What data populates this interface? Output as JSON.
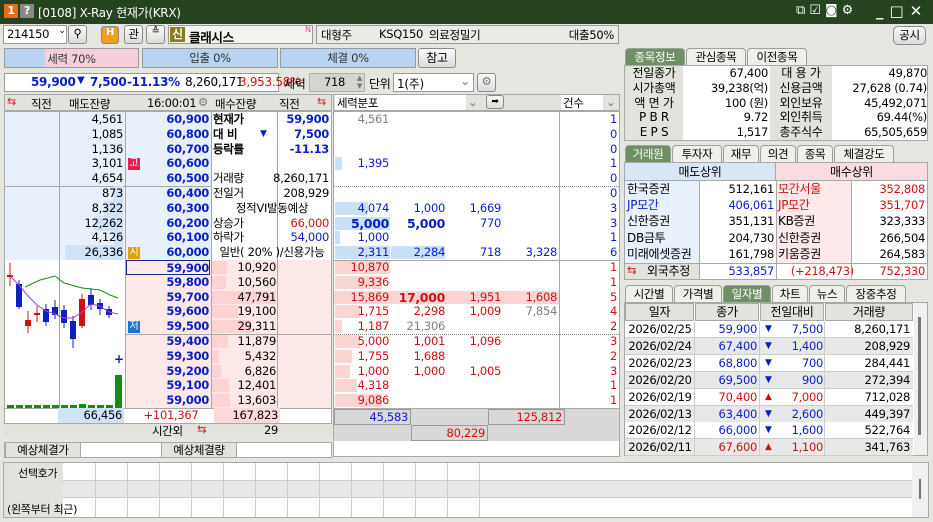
{
  "window": {
    "title": "[0108] X-Ray 현재가(KRX)",
    "badge1": "1",
    "badge2": "?"
  },
  "stock": {
    "code": "214150",
    "name": "클래시스",
    "credit_badge": "신",
    "gwan": "관",
    "new_mark": "N",
    "class": "대형주",
    "index": "KSQ150",
    "sector": "의료정밀기",
    "loan": "대출50%"
  },
  "strength": {
    "seryeok": "세력 70%",
    "seryeok_pct": 70,
    "ipchul": "입출 0%",
    "chegyeol": "체결 0%",
    "ref_button": "참고"
  },
  "summary": {
    "price": "59,900",
    "arrow": "▼",
    "change": "7,500",
    "rate": "-11.13%",
    "volume": "8,260,171",
    "vol_ratio": "3,953.58%"
  },
  "controls": {
    "seryeok_label": "세력",
    "seryeok_value": "718",
    "unit_label": "단위",
    "unit_value": "1(주)",
    "dist_select": "세력분포",
    "count_select": "건수",
    "gongsi": "공시"
  },
  "book_header": {
    "prev_left": "직전",
    "ask_qty": "매도잔량",
    "time": "16:00:01",
    "bid_qty": "매수잔량",
    "prev_right": "직전"
  },
  "asks": [
    {
      "qty": "4,561",
      "price": "60,900"
    },
    {
      "qty": "1,085",
      "price": "60,800"
    },
    {
      "qty": "1,136",
      "price": "60,700"
    },
    {
      "qty": "3,101",
      "price": "60,600",
      "badge": "고"
    },
    {
      "qty": "4,654",
      "price": "60,500"
    },
    {
      "qty": "873",
      "price": "60,400"
    },
    {
      "qty": "8,322",
      "price": "60,300"
    },
    {
      "qty": "12,262",
      "price": "60,200"
    },
    {
      "qty": "4,126",
      "price": "60,100"
    },
    {
      "qty": "26,336",
      "price": "60,000",
      "badge": "시"
    }
  ],
  "bids": [
    {
      "qty": "10,920",
      "price": "59,900",
      "bar": 0.23
    },
    {
      "qty": "10,560",
      "price": "59,800",
      "bar": 0.22
    },
    {
      "qty": "47,791",
      "price": "59,700",
      "bar": 1.0
    },
    {
      "qty": "19,100",
      "price": "59,600",
      "bar": 0.4
    },
    {
      "qty": "29,311",
      "price": "59,500",
      "bar": 0.61,
      "badge": "저"
    },
    {
      "qty": "11,879",
      "price": "59,400",
      "bar": 0.25
    },
    {
      "qty": "5,432",
      "price": "59,300",
      "bar": 0.11
    },
    {
      "qty": "6,826",
      "price": "59,200",
      "bar": 0.14
    },
    {
      "qty": "12,401",
      "price": "59,100",
      "bar": 0.26
    },
    {
      "qty": "13,603",
      "price": "59,000",
      "bar": 0.28
    }
  ],
  "info": [
    {
      "label": "현재가",
      "value": "59,900",
      "cls": "blue",
      "bold": true
    },
    {
      "label": "대  비",
      "arrow": "▼",
      "value": "7,500",
      "cls": "blue",
      "bold": true
    },
    {
      "label": "등락률",
      "value": "-11.13",
      "cls": "blue",
      "bold": true
    },
    {
      "label": "",
      "value": ""
    },
    {
      "label": "거래량",
      "value": "8,260,171"
    },
    {
      "label": "전일거",
      "value": "208,929"
    },
    {
      "label": "",
      "center": "정적VI발동예상"
    },
    {
      "label": "상승가",
      "value": "66,000",
      "cls": "red"
    },
    {
      "label": "하락가",
      "value": "54,000",
      "cls": "blue"
    },
    {
      "label": "",
      "center": "일반( 20% )/신용가능"
    }
  ],
  "totals": {
    "ask_total": "66,456",
    "diff": "+101,367",
    "bid_total": "167,823",
    "after_hours_label": "시간외",
    "after_hours_value": "29"
  },
  "expected": {
    "price_label": "예상체결가",
    "qty_label": "예상체결량"
  },
  "dist": [
    {
      "c": [
        "4,561",
        "",
        "",
        ""
      ],
      "n": "1",
      "side": "ask",
      "gray": [
        0
      ],
      "bar": 0
    },
    {
      "c": [
        "",
        "",
        "",
        ""
      ],
      "n": "0",
      "side": "ask",
      "bar": 0
    },
    {
      "c": [
        "",
        "",
        "",
        ""
      ],
      "n": "0",
      "side": "ask",
      "bar": 0
    },
    {
      "c": [
        "1,395",
        "",
        "",
        ""
      ],
      "n": "1",
      "side": "ask",
      "bar": 0.12
    },
    {
      "c": [
        "",
        "",
        "",
        ""
      ],
      "n": "0",
      "side": "ask",
      "bar": 0
    },
    {
      "c": [
        "",
        "",
        "",
        ""
      ],
      "n": "0",
      "side": "ask",
      "bar": 0
    },
    {
      "c": [
        "4,074",
        "1,000",
        "1,669",
        ""
      ],
      "n": "3",
      "side": "ask",
      "bar": 0.6
    },
    {
      "c": [
        "5,000",
        "5,000",
        "770",
        ""
      ],
      "n": "3",
      "side": "ask",
      "bold": [
        0,
        1
      ],
      "bar": 1.0
    },
    {
      "c": [
        "1,000",
        "",
        "",
        ""
      ],
      "n": "1",
      "side": "ask",
      "bar": 0.09
    },
    {
      "c": [
        "2,311",
        "2,284",
        "718",
        "3,328"
      ],
      "n": "6",
      "side": "ask",
      "bar": 1.0,
      "bar2": true
    },
    {
      "c": [
        "10,870",
        "",
        "",
        ""
      ],
      "n": "1",
      "side": "bid",
      "bar": 1.0
    },
    {
      "c": [
        "9,336",
        "",
        "",
        ""
      ],
      "n": "1",
      "side": "bid",
      "bar": 0.85
    },
    {
      "c": [
        "15,869",
        "17,000",
        "1,951",
        "1,608"
      ],
      "n": "5",
      "side": "bid",
      "bold": [
        1
      ],
      "bar": 1.0,
      "full": true
    },
    {
      "c": [
        "1,715",
        "2,298",
        "1,009",
        "7,854"
      ],
      "n": "4",
      "side": "bid",
      "gray": [
        3
      ],
      "bar": 0.45
    },
    {
      "c": [
        "1,187",
        "21,306",
        "",
        ""
      ],
      "n": "2",
      "side": "bid",
      "gray": [
        1
      ],
      "bar": 0.12
    },
    {
      "c": [
        "5,000",
        "1,001",
        "1,096",
        ""
      ],
      "n": "3",
      "side": "bid",
      "bar": 0.45
    },
    {
      "c": [
        "1,755",
        "1,688",
        "",
        ""
      ],
      "n": "2",
      "side": "bid",
      "bar": 0.3
    },
    {
      "c": [
        "1,000",
        "1,000",
        "1,005",
        ""
      ],
      "n": "3",
      "side": "bid",
      "bar": 0.27
    },
    {
      "c": [
        "4,318",
        "",
        "",
        ""
      ],
      "n": "1",
      "side": "bid",
      "bar": 0.4
    },
    {
      "c": [
        "9,086",
        "",
        "",
        ""
      ],
      "n": "1",
      "side": "bid",
      "bar": 0.85
    }
  ],
  "dist_totals": {
    "ask": "45,583",
    "bid": "125,812",
    "net": "80,229"
  },
  "stock_tabs": [
    "종목정보",
    "관심종목",
    "이전종목"
  ],
  "stock_info": [
    {
      "l1": "전일종가",
      "v1": "67,400",
      "l2": "대 용 가",
      "v2": "49,870"
    },
    {
      "l1": "시가총액",
      "v1": "39,238(억)",
      "l2": "신용금액",
      "v2": "27,628   (0.74)"
    },
    {
      "l1": "액 면 가",
      "v1": "100 (원)",
      "l2": "외인보유",
      "v2": "45,492,071"
    },
    {
      "l1": "P B R",
      "v1": "9.72",
      "l2": "외인취득",
      "v2": "69.44(%)"
    },
    {
      "l1": "E P S",
      "v1": "1,517",
      "l2": "총주식수",
      "v2": "65,505,659"
    }
  ],
  "broker_tabs": [
    "거래원",
    "투자자",
    "재무",
    "의견",
    "종목",
    "체결강도"
  ],
  "brokers": {
    "sell_header": "매도상위",
    "buy_header": "매수상위",
    "rows": [
      {
        "s": "한국증권",
        "sv": "512,161",
        "b": "모간서울",
        "bv": "352,808",
        "sc": "",
        "bc": "red"
      },
      {
        "s": "JP모간",
        "sv": "406,061",
        "b": "JP모간",
        "bv": "351,707",
        "sc": "blue",
        "bc": "red"
      },
      {
        "s": "신한증권",
        "sv": "351,131",
        "b": "KB증권",
        "bv": "323,333",
        "sc": "",
        "bc": ""
      },
      {
        "s": "DB금투",
        "sv": "204,730",
        "b": "신한증권",
        "bv": "266,504",
        "sc": "",
        "bc": ""
      },
      {
        "s": "미래에셋증권",
        "sv": "161,798",
        "b": "키움증권",
        "bv": "264,583",
        "sc": "",
        "bc": ""
      }
    ],
    "foreign_label": "외국추정",
    "foreign_sell": "533,857",
    "foreign_net": "(+218,473)",
    "foreign_buy": "752,330"
  },
  "daily_tabs": [
    "시간별",
    "가격별",
    "일자별",
    "차트",
    "뉴스",
    "장중추정"
  ],
  "daily": {
    "headers": [
      "일자",
      "종가",
      "전일대비",
      "거래량"
    ],
    "rows": [
      {
        "d": "2026/02/25",
        "p": "59,900",
        "dir": "down",
        "c": "7,500",
        "v": "8,260,171"
      },
      {
        "d": "2026/02/24",
        "p": "67,400",
        "dir": "down",
        "c": "1,400",
        "v": "208,929"
      },
      {
        "d": "2026/02/23",
        "p": "68,800",
        "dir": "down",
        "c": "700",
        "v": "284,441"
      },
      {
        "d": "2026/02/20",
        "p": "69,500",
        "dir": "down",
        "c": "900",
        "v": "272,394"
      },
      {
        "d": "2026/02/19",
        "p": "70,400",
        "dir": "up",
        "c": "7,000",
        "v": "712,028"
      },
      {
        "d": "2026/02/13",
        "p": "63,400",
        "dir": "down",
        "c": "2,600",
        "v": "449,397"
      },
      {
        "d": "2026/02/12",
        "p": "66,000",
        "dir": "down",
        "c": "1,600",
        "v": "522,764"
      },
      {
        "d": "2026/02/11",
        "p": "67,600",
        "dir": "up",
        "c": "1,100",
        "v": "341,763"
      }
    ]
  },
  "bottom": {
    "label1": "선택호가",
    "label2": "(왼쪽부터 최근)"
  },
  "colors": {
    "title_bg": "#25431f",
    "up": "#d01010",
    "down": "#0a1ec8",
    "ask_bg": "#e8f0fb",
    "bid_bg": "#fde8e8",
    "tab_active": "#6f8f64"
  }
}
